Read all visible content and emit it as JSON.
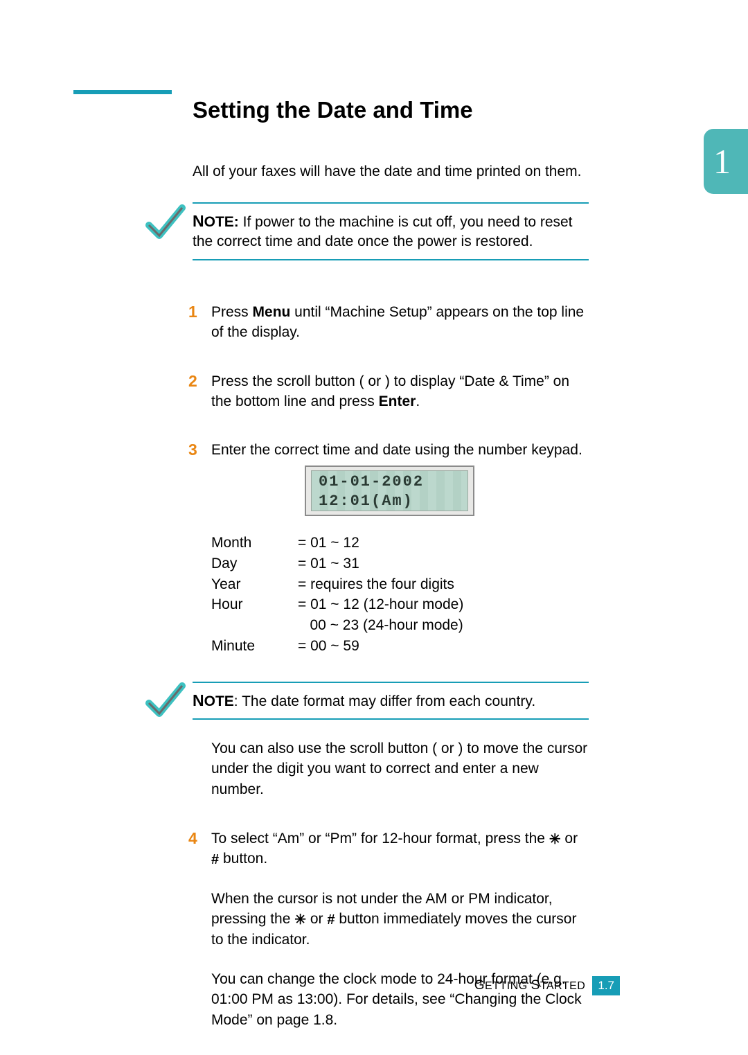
{
  "chapter_tab": "1",
  "title": "Setting the Date and Time",
  "intro": "All of your faxes will have the date and time printed on them.",
  "note1_label": "Note:",
  "note1_text": " If power to the machine is cut off, you need to reset the correct time and date once the power is restored.",
  "steps": {
    "s1_num": "1",
    "s1_a": "Press ",
    "s1_b": "Menu",
    "s1_c": " until “Machine Setup” appears on the top line of the display.",
    "s2_num": "2",
    "s2_a": "Press the scroll button (    or    ) to display “Date & Time” on the bottom line and press ",
    "s2_b": "Enter",
    "s2_c": ".",
    "s3_num": "3",
    "s3_a": "Enter the correct time and date using the number keypad.",
    "s4_num": "4",
    "s4_a": "To select “Am” or “Pm” for 12-hour format, press the ",
    "s4_sym1": "✳",
    "s4_b": " or ",
    "s4_sym2": "#",
    "s4_c": " button.",
    "s4_p2a": "When the cursor is not under the AM or PM indicator, pressing the ",
    "s4_p2b": " or ",
    "s4_p2c": " button immediately moves the cursor to the indicator.",
    "s4_p3": "You can change the clock mode to 24-hour format (e.g. 01:00 PM as 13:00). For details, see “Changing the Clock Mode” on page 1.8."
  },
  "lcd": {
    "line1": "01-01-2002",
    "line2": "12:01(Am)"
  },
  "ranges": {
    "month_l": "Month",
    "month_v": "= 01 ~ 12",
    "day_l": "Day",
    "day_v": "= 01 ~ 31",
    "year_l": "Year",
    "year_v": "= requires the four digits",
    "hour_l": "Hour",
    "hour_v": "= 01 ~ 12 (12-hour mode)",
    "hour2_v": "   00 ~ 23 (24-hour mode)",
    "min_l": "Minute",
    "min_v": "= 00 ~ 59"
  },
  "note2_label": "Note",
  "note2_text": ": The date format may differ from each country.",
  "post_a": "You can also use the scroll button (     or     ) to move the cursor under the digit you want to correct and enter a new number.",
  "footer": {
    "section": "Getting Started",
    "page": "1.7"
  }
}
